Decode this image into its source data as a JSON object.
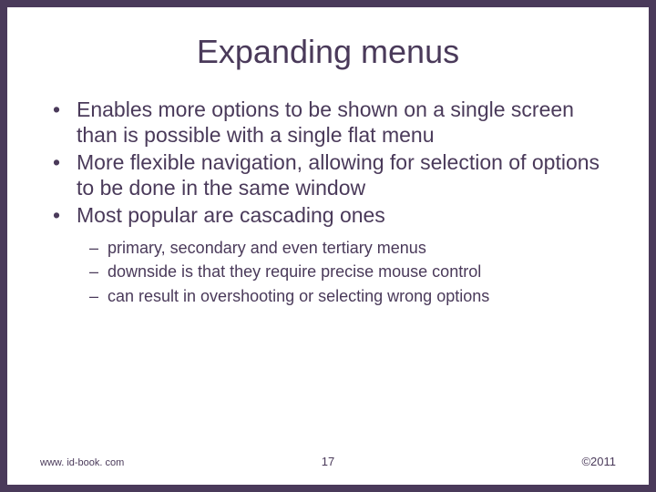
{
  "title": "Expanding menus",
  "bullets": [
    "Enables more options to be shown on a single screen than is possible with a single flat menu",
    "More flexible navigation, allowing for selection of options to be done in the same window",
    "Most popular are cascading ones"
  ],
  "subbullets": [
    "primary, secondary and even tertiary menus",
    "downside is that they require precise mouse control",
    "can result in overshooting or selecting wrong options"
  ],
  "footer": {
    "url": "www. id-book. com",
    "page": "17",
    "copyright": "©2011"
  }
}
